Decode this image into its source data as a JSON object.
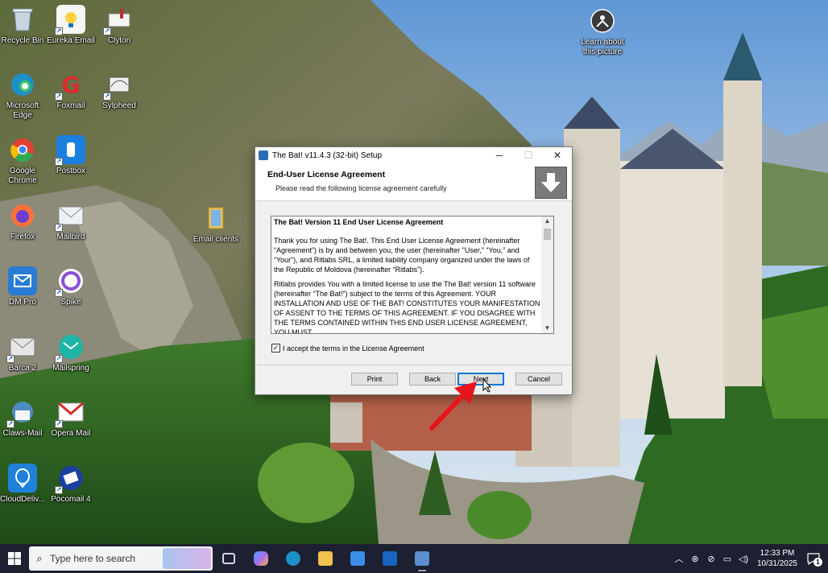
{
  "desktop": {
    "icons": [
      {
        "label": "Recycle Bin",
        "icon": "recycle-bin-icon",
        "color": "#9fb4c7"
      },
      {
        "label": "Eureka Email",
        "icon": "eureka-email-icon",
        "color": "#1a73c8"
      },
      {
        "label": "Clyton",
        "icon": "clyton-icon",
        "color": "#c22b2b"
      },
      {
        "label": "Microsoft Edge",
        "icon": "edge-icon",
        "color": "#1e90c8"
      },
      {
        "label": "Foxmail",
        "icon": "foxmail-icon",
        "color": "#e02a2a"
      },
      {
        "label": "Sylpheed",
        "icon": "sylpheed-icon",
        "color": "#e6e6e6"
      },
      {
        "label": "Google Chrome",
        "icon": "chrome-icon",
        "color": "#e34133"
      },
      {
        "label": "Postbox",
        "icon": "postbox-icon",
        "color": "#1b7fe0"
      },
      {
        "label": "Email clients",
        "icon": "folder-icon",
        "color": "#e8c25a"
      },
      {
        "label": "Firefox",
        "icon": "firefox-icon",
        "color": "#ff7139"
      },
      {
        "label": "Mailbird",
        "icon": "mailbird-icon",
        "color": "#eef2f6"
      },
      {
        "label": "DM Pro",
        "icon": "dm-pro-icon",
        "color": "#2a7bd4"
      },
      {
        "label": "Spike",
        "icon": "spike-icon",
        "color": "#8a4fd8"
      },
      {
        "label": "Barca 2",
        "icon": "barca-icon",
        "color": "#e6e6e6"
      },
      {
        "label": "Mailspring",
        "icon": "mailspring-icon",
        "color": "#1fb5a6"
      },
      {
        "label": "Claws-Mail",
        "icon": "claws-mail-icon",
        "color": "#4e8bc4"
      },
      {
        "label": "Opera Mail",
        "icon": "opera-mail-icon",
        "color": "#d62b2b"
      },
      {
        "label": "CloudDeliv...",
        "icon": "cloud-delivery-icon",
        "color": "#1f82d8"
      },
      {
        "label": "Pocomail 4",
        "icon": "pocomail-icon",
        "color": "#1c3e9e"
      },
      {
        "label": "Learn about this picture",
        "icon": "camera-info-icon",
        "color": "#3a3a3a"
      }
    ]
  },
  "installer": {
    "title": "The Bat! v11.4.3 (32-bit) Setup",
    "controls": {
      "minimize": "─",
      "maximize": "☐",
      "close": "✕"
    },
    "heading": "End-User License Agreement",
    "subheading": "Please read the following license agreement carefully",
    "license": {
      "title": "The Bat! Version 11 End User License Agreement",
      "p1": "Thank you for using The Bat!. This End User License Agreement (hereinafter “Agreement”) is by and between you, the user (hereinafter \"User,\" “You,” and “Your”), and Ritlabs SRL, a limited liability company organized under the laws of the Republic of Moldova (hereinafter “Ritlabs”).",
      "p2": "Ritlabs provides You with a limited license to use the The Bat! version 11 software (hereinafter “The Bat!”) subject to the terms of this Agreement. YOUR INSTALLATION AND USE OF THE BAT! CONSTITUTES YOUR MANIFESTATION OF ASSENT TO THE TERMS OF THIS AGREEMENT. IF YOU DISAGREE WITH THE TERMS CONTAINED WITHIN THIS END USER LICENSE AGREEMENT, YOU MUST"
    },
    "accept_label": "I accept the terms in the License Agreement",
    "accept_checked": true,
    "buttons": {
      "print": "Print",
      "back": "Back",
      "next": "Next",
      "cancel": "Cancel"
    }
  },
  "taskbar": {
    "search_placeholder": "Type here to search",
    "pinned": [
      {
        "name": "task-view-icon",
        "color": "#cfd6e4"
      },
      {
        "name": "copilot-icon",
        "color": "#a66cf0"
      },
      {
        "name": "edge-taskbar-icon",
        "color": "#1e90c8"
      },
      {
        "name": "file-explorer-icon",
        "color": "#f2c14e"
      },
      {
        "name": "microsoft-store-icon",
        "color": "#3a8ee6"
      },
      {
        "name": "outlook-icon",
        "color": "#1666c2"
      },
      {
        "name": "setup-taskbar-icon",
        "color": "#5b8fcf"
      }
    ],
    "time": "12:33 PM",
    "date": "10/31/2025",
    "notification_count": "1"
  }
}
